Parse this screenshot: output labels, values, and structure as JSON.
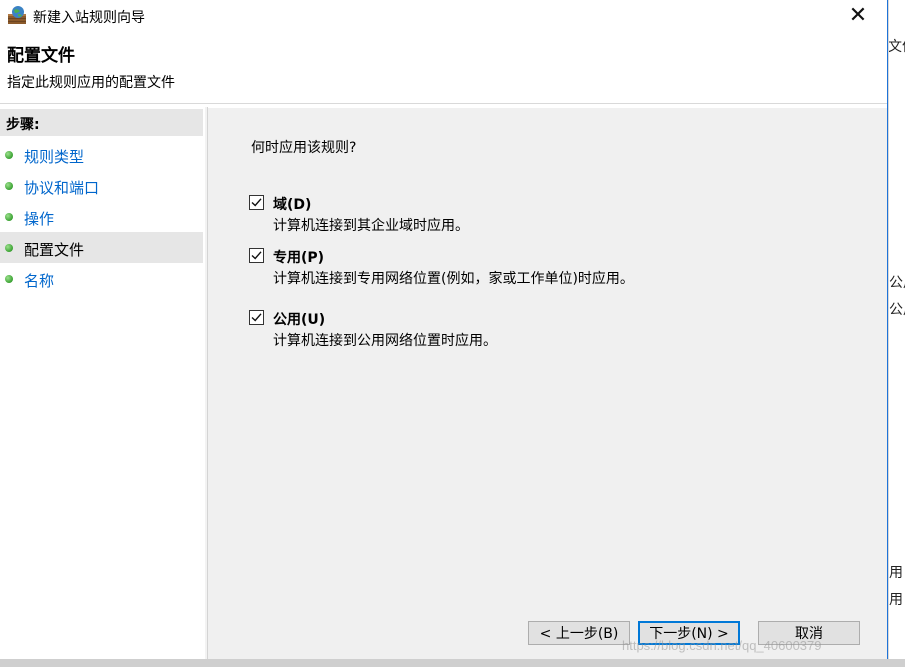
{
  "window": {
    "title": "新建入站规则向导",
    "close_glyph": "✕"
  },
  "header": {
    "title": "配置文件",
    "subtitle": "指定此规则应用的配置文件"
  },
  "steps": {
    "heading": "步骤:",
    "items": [
      {
        "label": "规则类型",
        "current": false
      },
      {
        "label": "协议和端口",
        "current": false
      },
      {
        "label": "操作",
        "current": false
      },
      {
        "label": "配置文件",
        "current": true
      },
      {
        "label": "名称",
        "current": false
      }
    ]
  },
  "main": {
    "question": "何时应用该规则?",
    "options": [
      {
        "label": "域(D)",
        "description": "计算机连接到其企业域时应用。",
        "checked": true
      },
      {
        "label": "专用(P)",
        "description": "计算机连接到专用网络位置(例如，家或工作单位)时应用。",
        "checked": true
      },
      {
        "label": "公用(U)",
        "description": "计算机连接到公用网络位置时应用。",
        "checked": true
      }
    ]
  },
  "buttons": {
    "back": "< 上一步(B)",
    "next": "下一步(N) >",
    "cancel": "取消"
  },
  "background_window": {
    "fragments": [
      "文件",
      "公用",
      "公用",
      "用",
      "用"
    ]
  },
  "watermark": "https://blog.csdn.net/qq_40600379",
  "colors": {
    "accent": "#0078d7",
    "link": "#0066cc",
    "content_bg": "#f0f0f0",
    "selected_step_bg": "#e6e6e6",
    "step_dot": "#3aa232"
  }
}
